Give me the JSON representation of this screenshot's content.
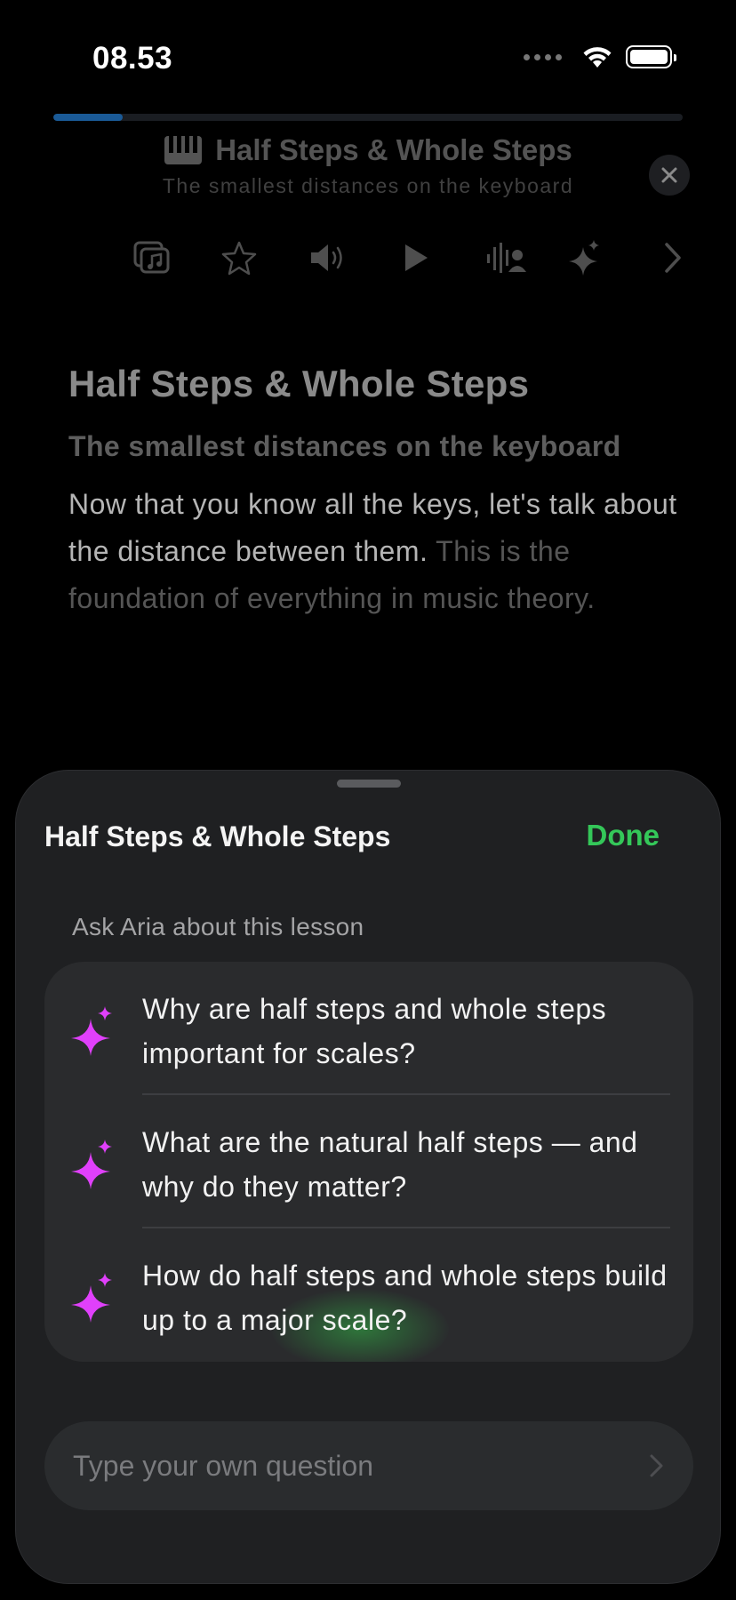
{
  "status_bar": {
    "time": "08.53"
  },
  "progress": {
    "fraction": 0.11,
    "color": "#1a5a97"
  },
  "header": {
    "title": "Half Steps & Whole Steps",
    "subtitle": "The smallest distances on the keyboard"
  },
  "toolbar": {
    "icons": [
      "music-library-icon",
      "star-icon",
      "speaker-icon",
      "play-icon",
      "voice-person-icon",
      "sparkles-icon",
      "chevron-right-icon"
    ]
  },
  "lesson": {
    "title": "Half Steps & Whole Steps",
    "subtitle": "The smallest distances on the keyboard",
    "body_bright": "Now that you know all the keys, let's talk about the distance between them.",
    "body_dim": "This is the foundation of everything in music theory."
  },
  "sheet": {
    "title": "Half Steps & Whole Steps",
    "done_label": "Done",
    "ask_label": "Ask Aria about this lesson",
    "questions": [
      "Why are half steps and whole steps important for scales?",
      "What are the natural half steps — and why do they matter?",
      "How do half steps and whole steps build up to a major scale?"
    ],
    "input_placeholder": "Type your own question"
  },
  "colors": {
    "accent_done": "#34c759",
    "sparkle": "#e040fb",
    "progress": "#1a5a97"
  }
}
